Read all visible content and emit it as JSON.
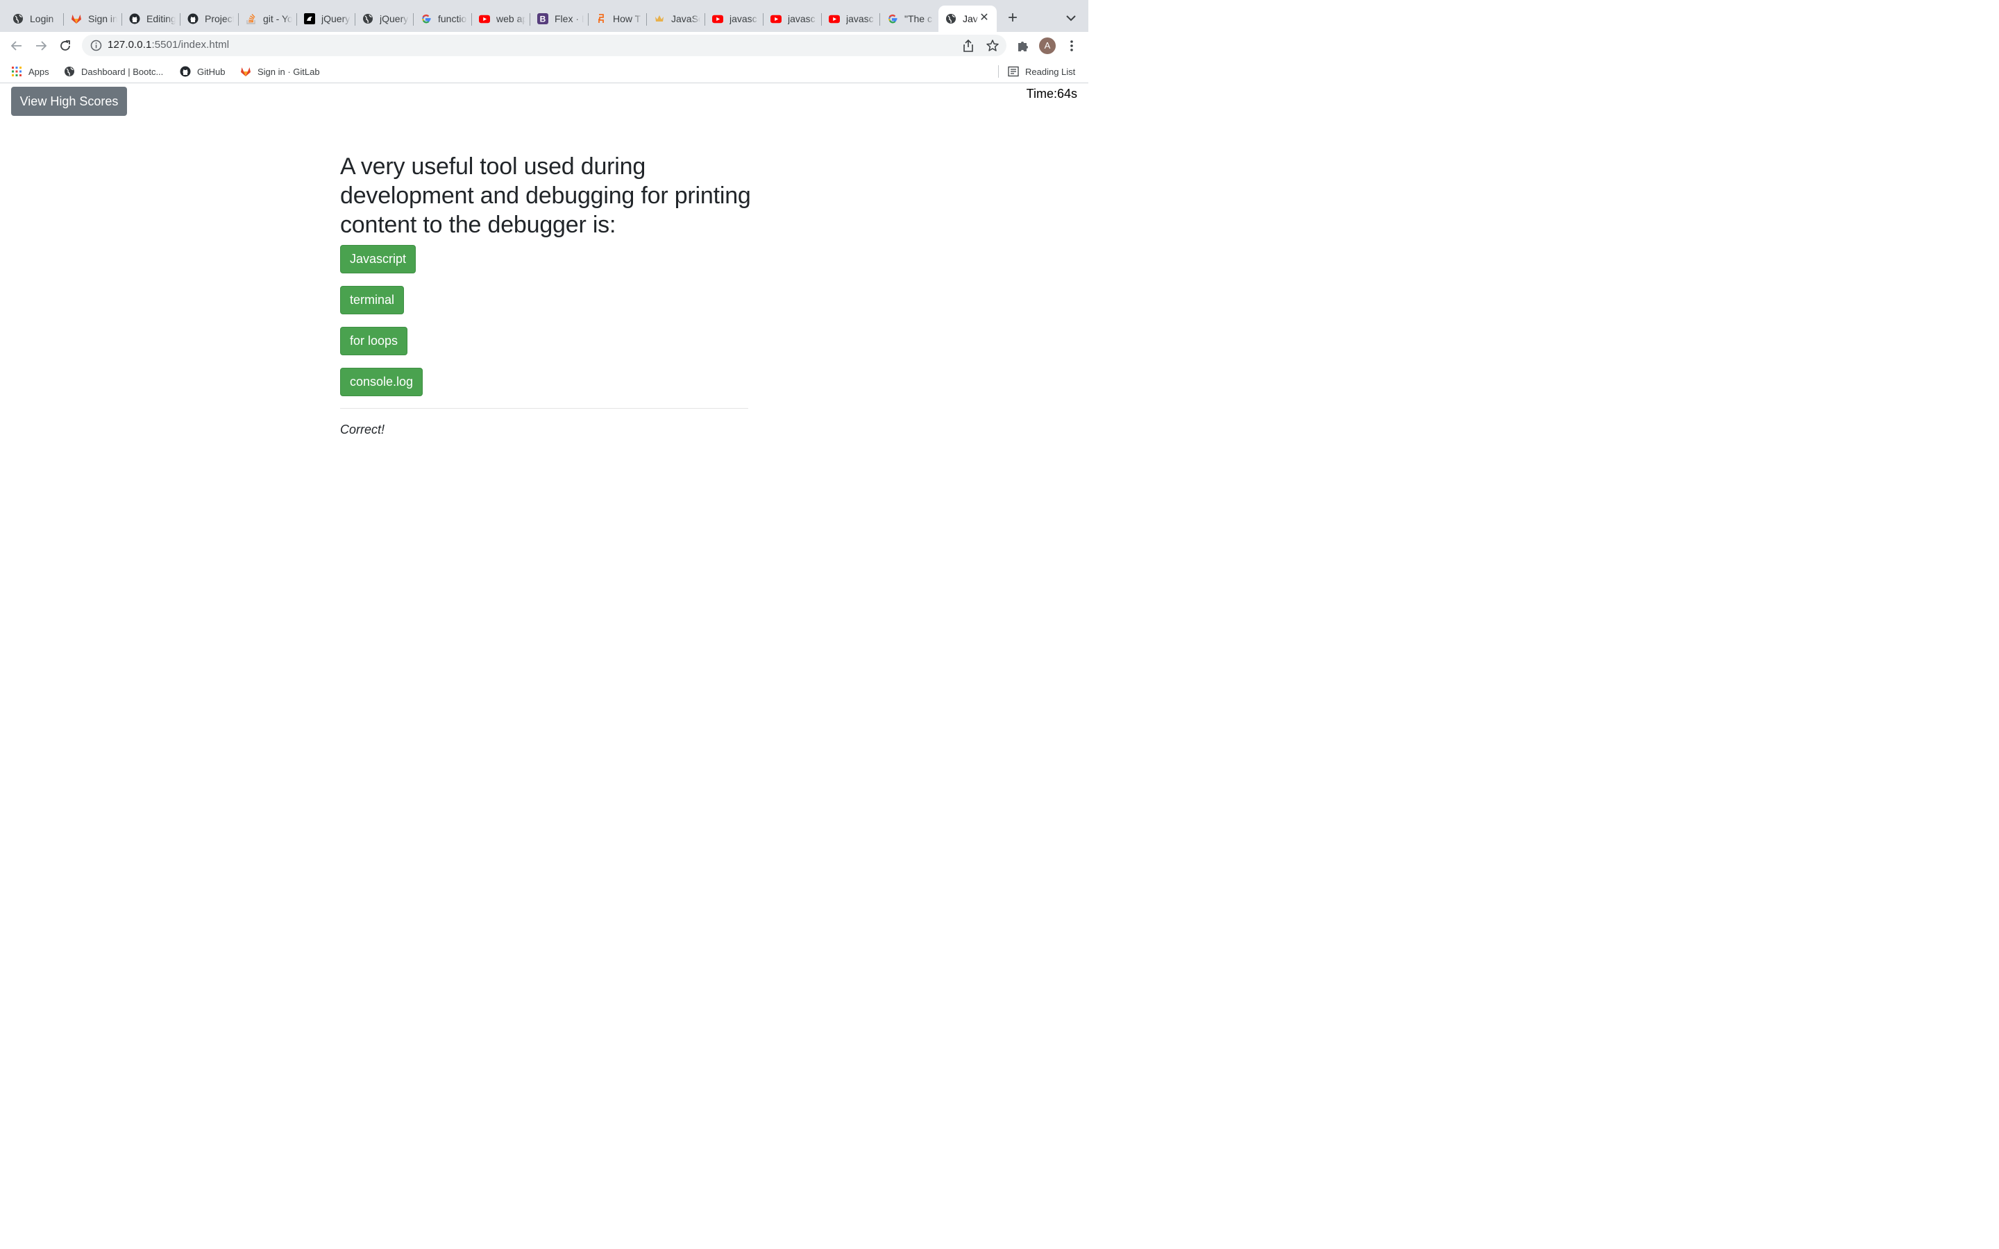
{
  "browser": {
    "tabs": [
      {
        "title": "Login",
        "icon": "globe-icon"
      },
      {
        "title": "Sign in",
        "icon": "gitlab-icon"
      },
      {
        "title": "Editing",
        "icon": "github-icon"
      },
      {
        "title": "Project",
        "icon": "github-icon"
      },
      {
        "title": "git - Yo",
        "icon": "stackoverflow-icon"
      },
      {
        "title": "jQuery",
        "icon": "codepen-icon"
      },
      {
        "title": "jQuery",
        "icon": "globe-icon"
      },
      {
        "title": "functio",
        "icon": "google-icon"
      },
      {
        "title": "web ap",
        "icon": "youtube-icon"
      },
      {
        "title": "Flex · B",
        "icon": "bootstrap-icon"
      },
      {
        "title": "How T",
        "icon": "sololearn-icon"
      },
      {
        "title": "JavaSc",
        "icon": "crown-icon"
      },
      {
        "title": "javasc",
        "icon": "youtube-icon"
      },
      {
        "title": "javasc",
        "icon": "youtube-icon"
      },
      {
        "title": "javasc",
        "icon": "youtube-icon"
      },
      {
        "title": "\"The c",
        "icon": "google-icon"
      },
      {
        "title": "Jav",
        "icon": "globe-icon",
        "active": true
      }
    ],
    "url_host": "127.0.0.1",
    "url_rest": ":5501/index.html",
    "profile_initial": "A",
    "bookmarks": {
      "apps": "Apps",
      "dashboard": "Dashboard | Bootc...",
      "github": "GitHub",
      "gitlab": "Sign in · GitLab",
      "reading_list": "Reading List"
    }
  },
  "quiz": {
    "high_scores_label": "View High Scores",
    "timer_label": "Time:",
    "timer_value": "64s",
    "question": "A very useful tool used during development and debugging for printing content to the debugger is:",
    "answers": [
      "Javascript",
      "terminal",
      "for loops",
      "console.log"
    ],
    "feedback": "Correct!",
    "colors": {
      "answer_bg": "#4aa24f",
      "high_scores_bg": "#6c757d"
    }
  }
}
